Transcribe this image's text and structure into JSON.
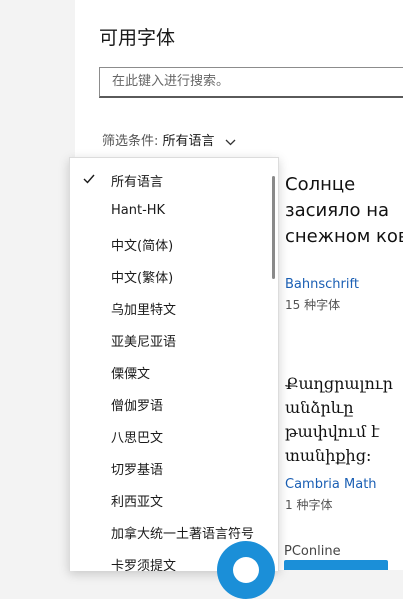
{
  "header": {
    "title": "可用字体"
  },
  "search": {
    "placeholder": "在此键入进行搜索。",
    "value": ""
  },
  "filter": {
    "label": "筛选条件:",
    "value": "所有语言"
  },
  "dropdown": {
    "selected_index": 0,
    "items": [
      "所有语言",
      "Hant-HK",
      "中文(简体)",
      "中文(繁体)",
      "乌加里特文",
      "亚美尼亚语",
      "傈僳文",
      "僧伽罗语",
      "八思巴文",
      "切罗基语",
      "利西亚文",
      "加拿大统一土著语言符号",
      "卡罗须提文"
    ]
  },
  "fonts": [
    {
      "sample_lines": [
        "Солнце",
        "засияло на",
        "снежном ковре"
      ],
      "name": "Bahnschrift",
      "count": "15 种字体"
    },
    {
      "sample_lines": [
        "Քաղցրալուր",
        "անձրևը",
        "թափվում է",
        "տանիքից:"
      ],
      "name": "Cambria Math",
      "count": "1 种字体"
    }
  ],
  "watermark": {
    "brand": "PConline"
  },
  "colors": {
    "link": "#1a5fb4",
    "accent": "#1b8fd8"
  }
}
